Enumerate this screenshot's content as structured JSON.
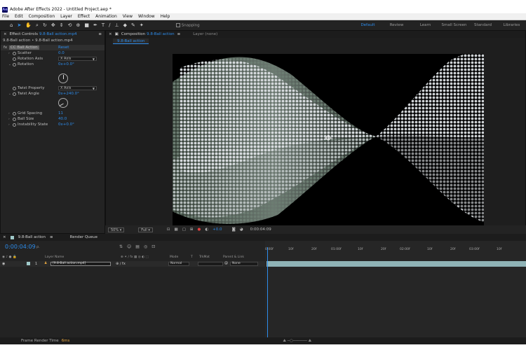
{
  "app": {
    "logo": "Ae",
    "window_title": "Adobe After Effects 2022 - Untitled Project.aep *"
  },
  "menu": [
    "File",
    "Edit",
    "Composition",
    "Layer",
    "Effect",
    "Animation",
    "View",
    "Window",
    "Help"
  ],
  "toolbar": {
    "tools": [
      "selection-icon",
      "hand-icon",
      "zoom-icon",
      "orbit-icon",
      "pan-icon",
      "dolly-icon",
      "rotate-icon",
      "anchor-icon",
      "shape-icon",
      "pen-icon",
      "type-icon",
      "brush-icon",
      "clone-icon",
      "eraser-icon",
      "roto-icon",
      "puppet-icon"
    ],
    "snapping_label": "Snapping",
    "workspaces": [
      "Default",
      "Review",
      "Learn",
      "Small Screen",
      "Standard",
      "Libraries"
    ],
    "active_workspace": "Default"
  },
  "effect_controls": {
    "tab_prefix": "Effect Controls",
    "tab_layer": "9.8-Ball action.mp4",
    "path": "9.8-Ball action • 9.8-Ball action.mp4",
    "effect_name": "CC Ball Action",
    "reset_label": "Reset",
    "props": {
      "scatter": {
        "label": "Scatter",
        "value": "0.0"
      },
      "rotation_axis": {
        "label": "Rotation Axis",
        "value": "X Axis"
      },
      "rotation": {
        "label": "Rotation",
        "value": "0x+0.0°"
      },
      "twist_property": {
        "label": "Twist Property",
        "value": "X Axis"
      },
      "twist_angle": {
        "label": "Twist Angle",
        "value": "0x+240.0°"
      },
      "grid_spacing": {
        "label": "Grid Spacing",
        "value": "11"
      },
      "ball_size": {
        "label": "Ball Size",
        "value": "40.0"
      },
      "instability_state": {
        "label": "Instability State",
        "value": "0x+0.0°"
      }
    }
  },
  "composition": {
    "tab_prefix": "Composition",
    "tab_name": "9.8-Ball action",
    "layer_tab": "Layer (none)",
    "breadcrumb": "9.8-Ball action"
  },
  "viewer_bar": {
    "zoom": "50%",
    "resolution": "Full",
    "exposure": "+0.0",
    "timecode": "0:00:04:09"
  },
  "timeline": {
    "tab_name": "9.8-Ball action",
    "render_queue": "Render Queue",
    "timecode": "0:00:04:09",
    "search_placeholder": "ρ.",
    "columns": {
      "layer_name": "Layer Name",
      "mode": "Mode",
      "t": "T",
      "trkmat": "TrkMat",
      "parent": "Parent & Link"
    },
    "layer": {
      "index": "1",
      "name": "[9.8-Ball action.mp4]",
      "mode": "Normal",
      "parent": "None"
    },
    "ruler": [
      "0:00f",
      "10f",
      "20f",
      "01:00f",
      "10f",
      "20f",
      "02:00f",
      "10f",
      "20f",
      "03:00f",
      "10f"
    ]
  },
  "status": {
    "label": "Frame Render Time",
    "value": "6ms"
  }
}
